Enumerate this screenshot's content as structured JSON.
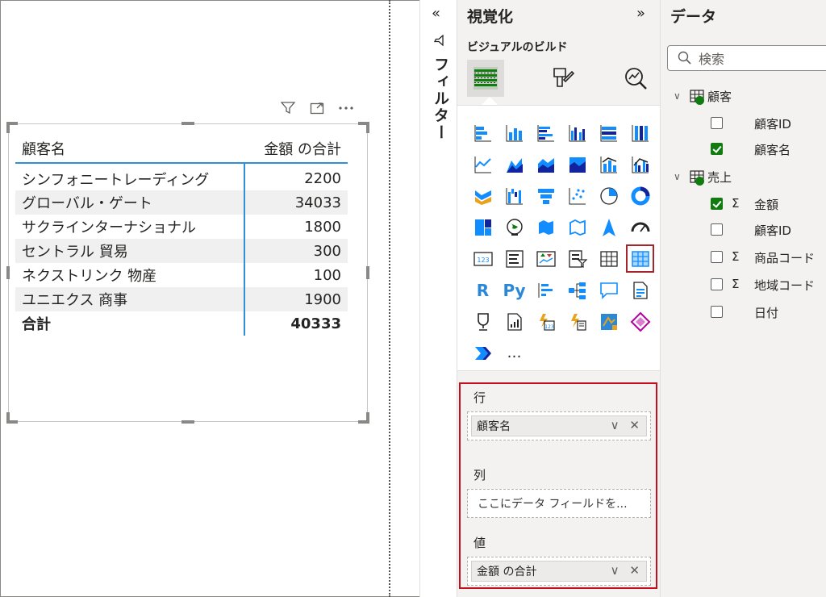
{
  "visual_header": {
    "filter_icon": "filter-icon",
    "focus_icon": "focus-mode-icon",
    "more_icon": "more-options-icon"
  },
  "table": {
    "columns": [
      "顧客名",
      "金額 の合計"
    ],
    "rows": [
      [
        "シンフォニートレーディング",
        "2200"
      ],
      [
        "グローバル・ゲート",
        "34033"
      ],
      [
        "サクラインターナショナル",
        "1800"
      ],
      [
        "セントラル 貿易",
        "300"
      ],
      [
        "ネクストリンク 物産",
        "100"
      ],
      [
        "ユニエクス 商事",
        "1900"
      ]
    ],
    "total": [
      "合計",
      "40333"
    ],
    "accent": "#2f8fd8"
  },
  "filter_pane": {
    "collapse_label": "«",
    "label": "フィルター"
  },
  "viz_pane": {
    "title": "視覚化",
    "expand_label": "»",
    "build_label": "ビジュアルのビルド",
    "tabs": [
      "build-visual-icon",
      "format-visual-icon",
      "analytics-icon"
    ],
    "more_label": "…",
    "selected_visual": "matrix-icon",
    "wells": {
      "rows_label": "行",
      "rows_field": "顧客名",
      "columns_label": "列",
      "columns_placeholder": "ここにデータ フィールドを...",
      "values_label": "値",
      "values_field": "金額 の合計",
      "pill_controls": "∨ ✕"
    }
  },
  "data_pane": {
    "title": "データ",
    "search_placeholder": "検索",
    "tables": [
      {
        "name": "顧客",
        "fields": [
          {
            "name": "顧客ID",
            "checked": false,
            "sigma": false
          },
          {
            "name": "顧客名",
            "checked": true,
            "sigma": false
          }
        ]
      },
      {
        "name": "売上",
        "fields": [
          {
            "name": "金額",
            "checked": true,
            "sigma": true
          },
          {
            "name": "顧客ID",
            "checked": false,
            "sigma": false
          },
          {
            "name": "商品コード",
            "checked": false,
            "sigma": true
          },
          {
            "name": "地域コード",
            "checked": false,
            "sigma": true
          },
          {
            "name": "日付",
            "checked": false,
            "sigma": false
          }
        ]
      }
    ],
    "sigma_symbol": "Σ",
    "chevron": "∨"
  }
}
